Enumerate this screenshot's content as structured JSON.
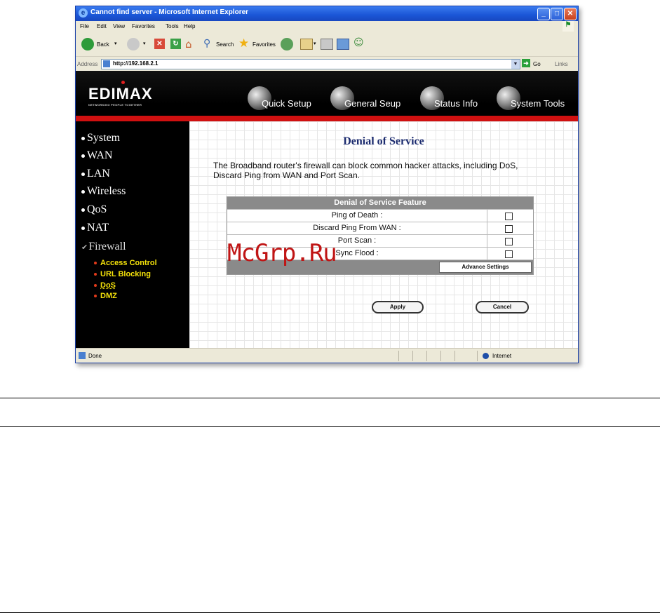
{
  "window": {
    "title": "Cannot find server - Microsoft Internet Explorer",
    "controls": {
      "minimize": "_",
      "maximize": "□",
      "close": "✕"
    }
  },
  "menu": [
    "File",
    "Edit",
    "View",
    "Favorites",
    "Tools",
    "Help"
  ],
  "toolbar": {
    "back_label": "Back",
    "search_label": "Search",
    "favorites_label": "Favorites"
  },
  "address": {
    "label": "Address",
    "url": "http://192.168.2.1",
    "go_label": "Go",
    "links_label": "Links"
  },
  "banner": {
    "logo": "EDIMAX",
    "tagline": "NETWORKING PEOPLE TOGETHER",
    "nav": [
      "Quick Setup",
      "General Seup",
      "Status Info",
      "System Tools"
    ]
  },
  "sidebar": {
    "items": [
      "System",
      "WAN",
      "LAN",
      "Wireless",
      "QoS",
      "NAT"
    ],
    "active_item": "Firewall",
    "sub_items": [
      "Access Control",
      "URL Blocking",
      "DoS",
      "DMZ"
    ]
  },
  "main": {
    "title": "Denial of Service",
    "description": "The Broadband router's firewall can block common hacker attacks, including DoS, Discard Ping from WAN and Port Scan.",
    "table_header": "Denial of Service Feature",
    "rows": [
      {
        "label": "Ping of Death :",
        "checked": false
      },
      {
        "label": "Discard Ping From WAN :",
        "checked": false
      },
      {
        "label": "Port Scan :",
        "checked": false
      },
      {
        "label": "Sync Flood :",
        "checked": false
      }
    ],
    "advance_button": "Advance Settings",
    "apply_button": "Apply",
    "cancel_button": "Cancel"
  },
  "watermark": "McGrp.Ru",
  "status": {
    "text": "Done",
    "zone": "Internet"
  },
  "colors": {
    "banner": "#000000",
    "accent_red": "#d01010",
    "submenu_yellow": "#f5e20a",
    "title_blue": "#1a2a6e"
  }
}
